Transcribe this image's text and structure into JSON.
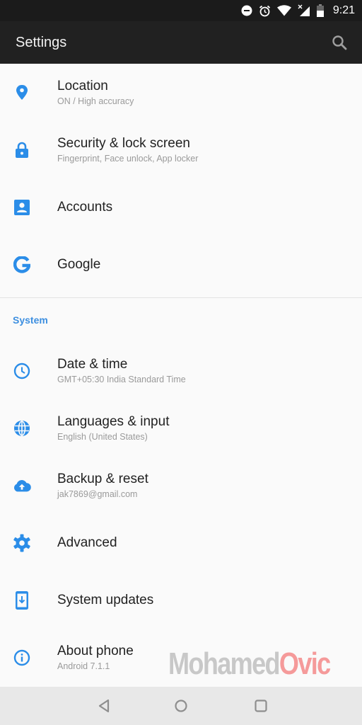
{
  "status_bar": {
    "icons": [
      "do-not-disturb-icon",
      "alarm-icon",
      "wifi-icon",
      "cellular-no-data-icon",
      "battery-icon"
    ],
    "time": "9:21"
  },
  "app_bar": {
    "title": "Settings",
    "search_icon": "search-icon"
  },
  "items_top": [
    {
      "icon": "location-pin-icon",
      "label": "Location",
      "sub": "ON / High accuracy"
    },
    {
      "icon": "lock-icon",
      "label": "Security & lock screen",
      "sub": "Fingerprint, Face unlock, App locker"
    },
    {
      "icon": "account-box-icon",
      "label": "Accounts",
      "sub": ""
    },
    {
      "icon": "google-icon",
      "label": "Google",
      "sub": ""
    }
  ],
  "section": {
    "title": "System"
  },
  "items_system": [
    {
      "icon": "clock-icon",
      "label": "Date & time",
      "sub": "GMT+05:30 India Standard Time"
    },
    {
      "icon": "globe-icon",
      "label": "Languages & input",
      "sub": "English (United States)"
    },
    {
      "icon": "cloud-upload-icon",
      "label": "Backup & reset",
      "sub": "jak7869@gmail.com"
    },
    {
      "icon": "gear-icon",
      "label": "Advanced",
      "sub": ""
    },
    {
      "icon": "system-update-icon",
      "label": "System updates",
      "sub": ""
    },
    {
      "icon": "info-icon",
      "label": "About phone",
      "sub": "Android 7.1.1"
    }
  ],
  "watermark": {
    "part1": "Mohamed",
    "part2": "Ovic"
  },
  "nav_bar": {
    "buttons": [
      "back-icon",
      "home-icon",
      "recents-icon"
    ]
  },
  "colors": {
    "accent": "#2b8de8",
    "appbar": "#212121",
    "statusbar": "#1b1b1b",
    "background": "#fafafa"
  }
}
